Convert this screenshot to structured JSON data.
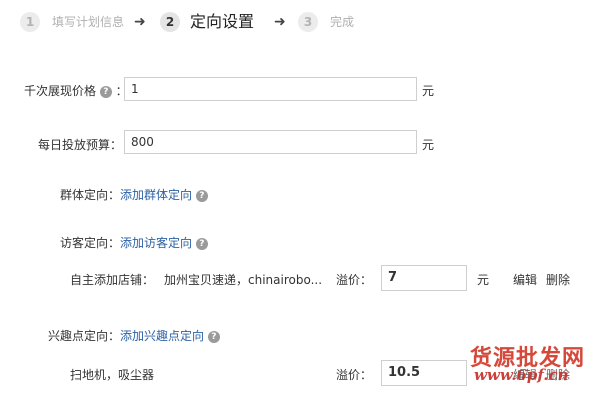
{
  "steps": [
    {
      "num": "1",
      "label": "填写计划信息"
    },
    {
      "num": "2",
      "label": "定向设置"
    },
    {
      "num": "3",
      "label": "完成"
    }
  ],
  "arrow_glyph": "➜",
  "cpm_price": {
    "label": "千次展现价格",
    "colon": "：",
    "value": "1",
    "unit": "元"
  },
  "daily_budget": {
    "label": "每日投放预算：",
    "value": "800",
    "unit": "元"
  },
  "group_targeting": {
    "label": "群体定向：",
    "link": "添加群体定向"
  },
  "visitor_targeting": {
    "label": "访客定向：",
    "link": "添加访客定向",
    "shop_row": {
      "label": "自主添加店铺：",
      "shops": "加州宝贝速递，chinairobo...",
      "premium_label": "溢价：",
      "premium_value": "7",
      "unit": "元",
      "edit": "编辑",
      "delete": "删除"
    }
  },
  "interest_targeting": {
    "label": "兴趣点定向：",
    "link": "添加兴趣点定向",
    "row": {
      "keywords": "扫地机，吸尘器",
      "premium_label": "溢价：",
      "premium_value": "10.5",
      "edit_partial": "编辑",
      "delete_partial": "删除"
    }
  },
  "help_glyph": "?",
  "watermark": {
    "text": "货源批发网",
    "url": "www.6pf.cn"
  }
}
